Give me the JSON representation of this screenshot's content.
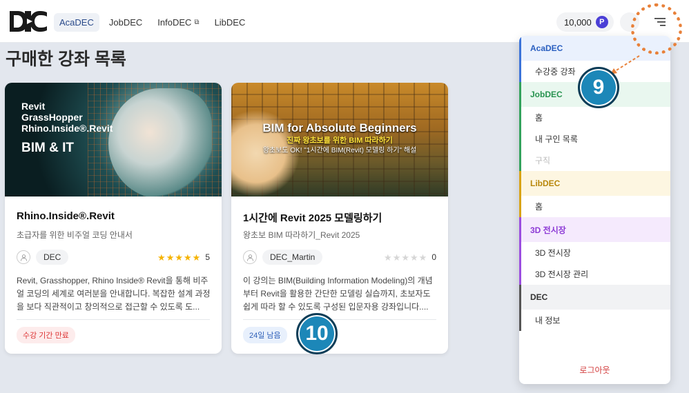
{
  "header": {
    "logo_text": "DEC",
    "nav": [
      {
        "label": "AcaDEC",
        "active": true
      },
      {
        "label": "JobDEC",
        "active": false
      },
      {
        "label": "InfoDEC",
        "active": false,
        "external": true
      },
      {
        "label": "LibDEC",
        "active": false
      }
    ],
    "points": "10,000",
    "points_badge": "P"
  },
  "page": {
    "title": "구매한 강좌 목록"
  },
  "courses": [
    {
      "thumb_lines": [
        "Revit",
        "GrassHopper",
        "Rhino.Inside®.Revit"
      ],
      "thumb_tag": "BIM & IT",
      "title": "Rhino.Inside®.Revit",
      "subtitle": "초급자를 위한 비주얼 코딩 안내서",
      "author": "DEC",
      "rating": 5,
      "rating_text": "5",
      "description": "Revit, Grasshopper, Rhino Inside® Revit을 통해 비주얼 코딩의 세계로 여러분을 안내합니다. 복잡한 설계 과정을 보다 직관적이고 창의적으로 접근할 수 있도록 도...",
      "status": "수강 기간 만료",
      "status_color": "#d33"
    },
    {
      "thumb_title": "BIM for Absolute Beginners",
      "thumb_sub1": "진짜 왕초보를 위한 BIM 따라하기",
      "thumb_sub2": "왕초보도 OK! \"1시간에 BIM(Revit) 모델링 하기\" 해설",
      "title": "1시간에 Revit 2025 모델링하기",
      "subtitle": "왕초보 BIM 따라하기_Revit 2025",
      "author": "DEC_Martin",
      "rating": 0,
      "rating_text": "0",
      "description": "이 강의는 BIM(Building Information Modeling)의 개념부터 Revit을 활용한 간단한 모델링 실습까지, 초보자도 쉽게 따라 할 수 있도록 구성된 입문자용 강좌입니다....",
      "status": "24일 남음",
      "status_color": "#2d5fb8"
    }
  ],
  "menu": {
    "sections": [
      {
        "header": "AcaDEC",
        "color": "#3b73d9",
        "items": [
          {
            "label": "수강중 강좌",
            "disabled": false
          }
        ]
      },
      {
        "header": "JobDEC",
        "color": "#33a25c",
        "items": [
          {
            "label": "홈",
            "disabled": false
          },
          {
            "label": "내 구인 목록",
            "disabled": false
          },
          {
            "label": "구직",
            "disabled": true
          }
        ]
      },
      {
        "header": "LibDEC",
        "color": "#d8a314",
        "items": [
          {
            "label": "홈",
            "disabled": false
          }
        ]
      },
      {
        "header": "3D 전시장",
        "color": "#9b4de0",
        "items": [
          {
            "label": "3D 전시장",
            "disabled": false
          },
          {
            "label": "3D 전시장 관리",
            "disabled": false
          }
        ]
      },
      {
        "header": "DEC",
        "color": "#555555",
        "items": [
          {
            "label": "내 정보",
            "disabled": false
          }
        ]
      }
    ],
    "logout": "로그아웃"
  },
  "callouts": {
    "nine": "9",
    "ten": "10"
  },
  "icons": {
    "external": "external-link-icon",
    "menu": "hamburger-menu-icon",
    "avatar": "user-icon",
    "star": "star-icon"
  },
  "colors": {
    "accent": "#1c87b8",
    "highlight": "#e8813a",
    "points_badge": "#4b3fd6"
  }
}
